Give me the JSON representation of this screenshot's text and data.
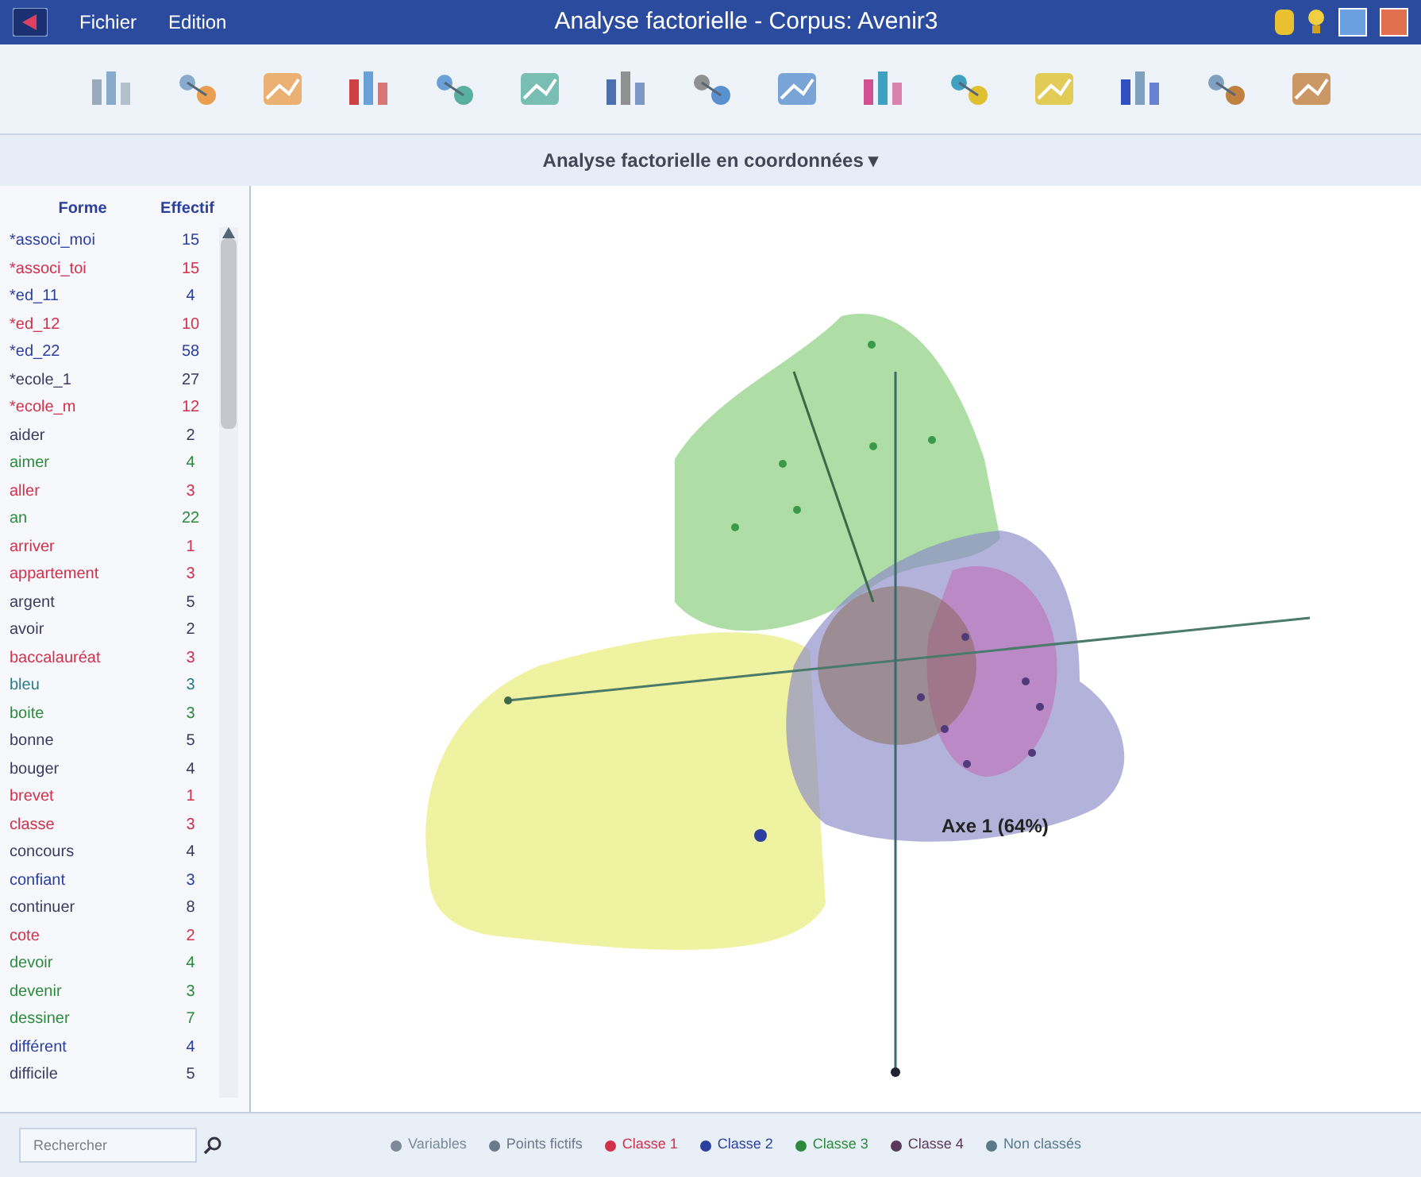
{
  "window": {
    "title": "Analyse factorielle - Corpus: Avenir3"
  },
  "menu": [
    "Fichier",
    "Edition"
  ],
  "view_selector": {
    "label": "Analyse factorielle en coordonnées ▾"
  },
  "table": {
    "columns": [
      "Forme",
      "Effectif"
    ],
    "rows": [
      {
        "form": "*associ_moi",
        "count": "15",
        "color": "#2a3f9e"
      },
      {
        "form": "*associ_toi",
        "count": "15",
        "color": "#d0304a"
      },
      {
        "form": "*ed_11",
        "count": "4",
        "color": "#2a3f9e"
      },
      {
        "form": "*ed_12",
        "count": "10",
        "color": "#d0304a"
      },
      {
        "form": "*ed_22",
        "count": "58",
        "color": "#2a3f9e"
      },
      {
        "form": "*ecole_1",
        "count": "27",
        "color": "#3a3a60"
      },
      {
        "form": "*ecole_m",
        "count": "12",
        "color": "#d0304a"
      },
      {
        "form": "aider",
        "count": "2",
        "color": "#3a3a60"
      },
      {
        "form": "aimer",
        "count": "4",
        "color": "#2c8a3c"
      },
      {
        "form": "aller",
        "count": "3",
        "color": "#d0304a"
      },
      {
        "form": "an",
        "count": "22",
        "color": "#2c8a3c"
      },
      {
        "form": "arriver",
        "count": "1",
        "color": "#d0304a"
      },
      {
        "form": "appartement",
        "count": "3",
        "color": "#d0304a"
      },
      {
        "form": "argent",
        "count": "5",
        "color": "#3a3a60"
      },
      {
        "form": "avoir",
        "count": "2",
        "color": "#3a3a60"
      },
      {
        "form": "baccalauréat",
        "count": "3",
        "color": "#d0304a"
      },
      {
        "form": "bleu",
        "count": "3",
        "color": "#2a7a8a"
      },
      {
        "form": "boite",
        "count": "3",
        "color": "#2c8a3c"
      },
      {
        "form": "bonne",
        "count": "5",
        "color": "#3a3a60"
      },
      {
        "form": "bouger",
        "count": "4",
        "color": "#3a3a60"
      },
      {
        "form": "brevet",
        "count": "1",
        "color": "#d0304a"
      },
      {
        "form": "classe",
        "count": "3",
        "color": "#d0304a"
      },
      {
        "form": "concours",
        "count": "4",
        "color": "#3a3a60"
      },
      {
        "form": "confiant",
        "count": "3",
        "color": "#2a3f9e"
      },
      {
        "form": "continuer",
        "count": "8",
        "color": "#3a3a60"
      },
      {
        "form": "cote",
        "count": "2",
        "color": "#d0304a"
      },
      {
        "form": "devoir",
        "count": "4",
        "color": "#2c8a3c"
      },
      {
        "form": "devenir",
        "count": "3",
        "color": "#2c8a3c"
      },
      {
        "form": "dessiner",
        "count": "7",
        "color": "#2c8a3c"
      },
      {
        "form": "différent",
        "count": "4",
        "color": "#2a3f9e"
      },
      {
        "form": "difficile",
        "count": "5",
        "color": "#3a3a60"
      }
    ]
  },
  "search": {
    "placeholder": "Rechercher"
  },
  "plot": {
    "axis_label": "Axe 1 (64%)"
  },
  "legend": [
    {
      "label": "Variables",
      "color": "#7a8a9a"
    },
    {
      "label": "Points fictifs",
      "color": "#6a7a8a"
    },
    {
      "label": "Classe 1",
      "color": "#d0304a"
    },
    {
      "label": "Classe 2",
      "color": "#2a3f9e"
    },
    {
      "label": "Classe 3",
      "color": "#2c8a3c"
    },
    {
      "label": "Classe 4",
      "color": "#5a3a5a"
    },
    {
      "label": "Non classés",
      "color": "#5a7a8a"
    }
  ]
}
